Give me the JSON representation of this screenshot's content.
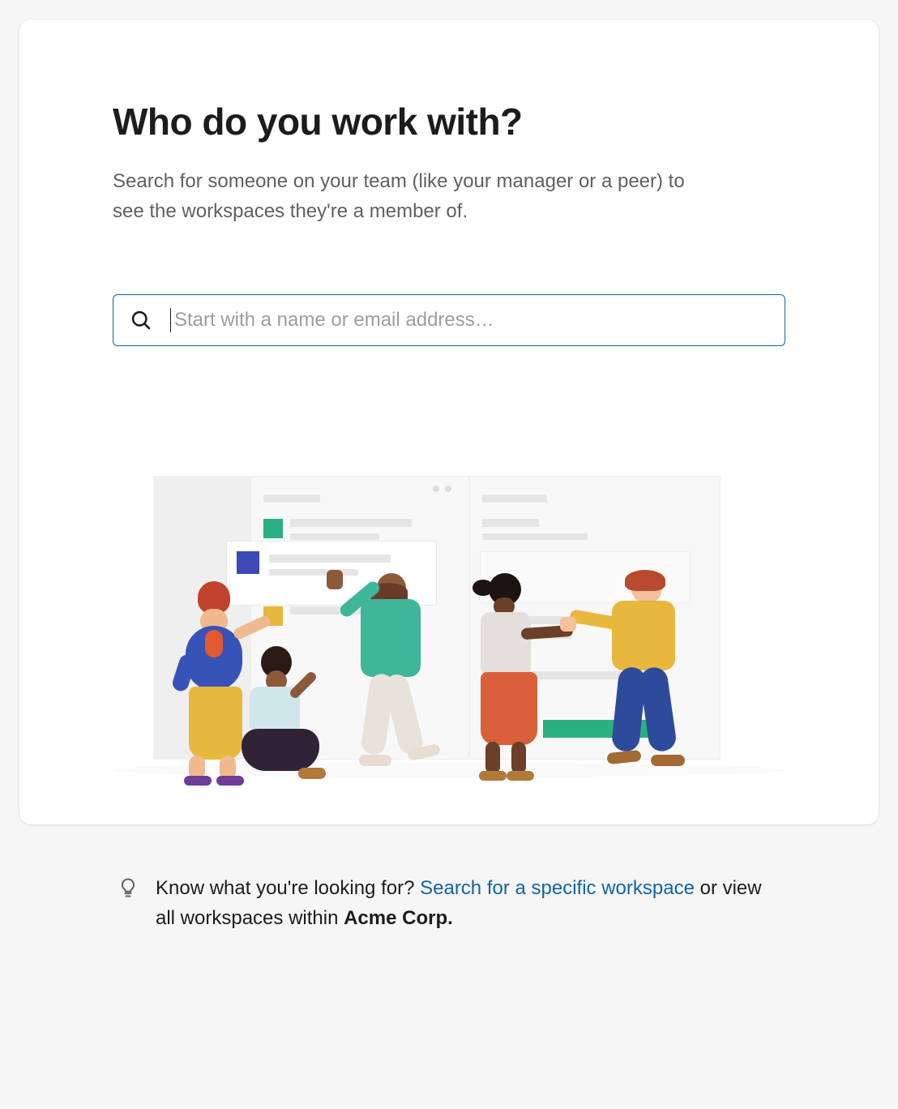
{
  "card": {
    "title": "Who do you work with?",
    "subtitle": "Search for someone on your team (like your manager or a peer) to see the workspaces they're a member of."
  },
  "search": {
    "placeholder": "Start with a name or email address…",
    "value": ""
  },
  "tip": {
    "lead": "Know what you're looking for? ",
    "link_text": "Search for a specific workspace",
    "tail_before_org": " or view all workspaces within ",
    "org_name": "Acme Corp."
  },
  "colors": {
    "accent": "#1264a3",
    "text": "#1d1c1d",
    "muted": "#616061"
  }
}
